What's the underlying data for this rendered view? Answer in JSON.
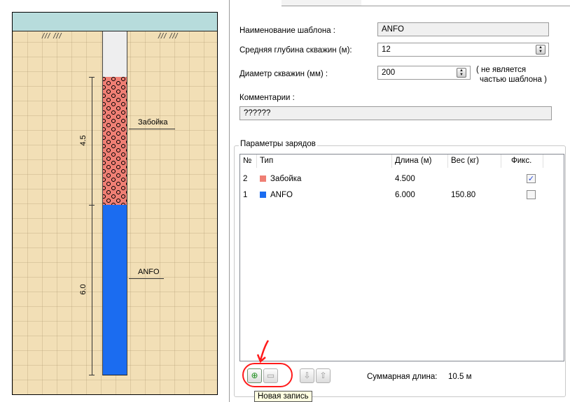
{
  "diagram": {
    "stemming_length": "4.5",
    "anfo_length": "6.0",
    "stemming_label": "Забойка",
    "anfo_label": "ANFO",
    "hatch_left": "/// ///",
    "hatch_right": "/// ///",
    "colors": {
      "stemming": "#ef7f74",
      "anfo": "#1b6cf0",
      "ground": "#f2dfb6",
      "sky": "#b7dcdc"
    }
  },
  "form": {
    "template_name_label": "Наименование шаблона :",
    "template_name_value": "ANFO",
    "depth_label": "Средняя глубина скважин (м):",
    "depth_value": "12",
    "diameter_label": "Диаметр скважин (мм) :",
    "diameter_value": "200",
    "diameter_note_1": "( не является",
    "diameter_note_2": "частью шаблона )",
    "comments_label": "Комментарии :",
    "comments_value": "??????"
  },
  "charges": {
    "group_title": "Параметры зарядов",
    "columns": [
      "№",
      "Тип",
      "Длина (м)",
      "Вес (кг)",
      "Фикс."
    ],
    "rows": [
      {
        "num": "2",
        "type": "Забойка",
        "icon": "stemming-swatch-icon",
        "length": "4.500",
        "weight": "",
        "fixed": true
      },
      {
        "num": "1",
        "type": "ANFO",
        "icon": "anfo-swatch-icon",
        "length": "6.000",
        "weight": "150.80",
        "fixed": false
      }
    ],
    "total_label": "Суммарная длина:",
    "total_value": "10.5 м",
    "add_button_tooltip": "Новая запись",
    "checked_glyph": "✓"
  }
}
